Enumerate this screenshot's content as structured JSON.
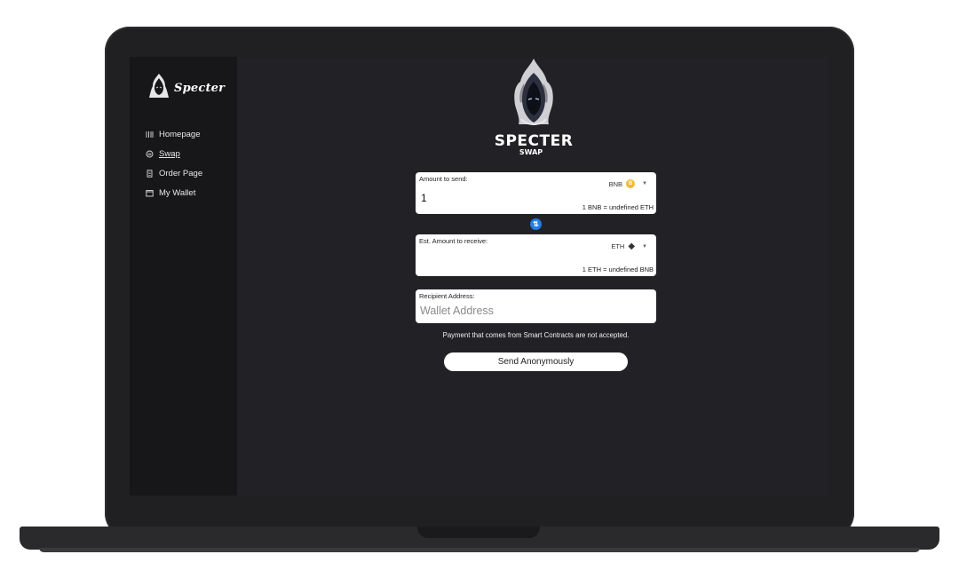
{
  "brand": {
    "name": "Specter"
  },
  "nav": {
    "items": [
      {
        "label": "Homepage",
        "icon": "bars-icon"
      },
      {
        "label": "Swap",
        "icon": "swap-icon",
        "active": true
      },
      {
        "label": "Order Page",
        "icon": "receipt-icon"
      },
      {
        "label": "My Wallet",
        "icon": "wallet-icon"
      }
    ]
  },
  "logo": {
    "line1": "SPECTER",
    "line2": "SWAP"
  },
  "send": {
    "label": "Amount to send:",
    "value": "1",
    "token": "BNB",
    "rate": "1 BNB = undefined ETH"
  },
  "receive": {
    "label": "Est. Amount to receive:",
    "value": "",
    "token": "ETH",
    "rate": "1 ETH = undefined BNB"
  },
  "recipient": {
    "label": "Recipient Address:",
    "placeholder": "Wallet Address"
  },
  "notice": "Payment that comes from Smart Contracts are not accepted.",
  "submit": {
    "label": "Send Anonymously"
  },
  "colors": {
    "screen_bg": "#222226",
    "sidebar_bg": "#171719",
    "swap_accent": "#1e7ee8",
    "bnb_coin": "#f3ba2f"
  }
}
